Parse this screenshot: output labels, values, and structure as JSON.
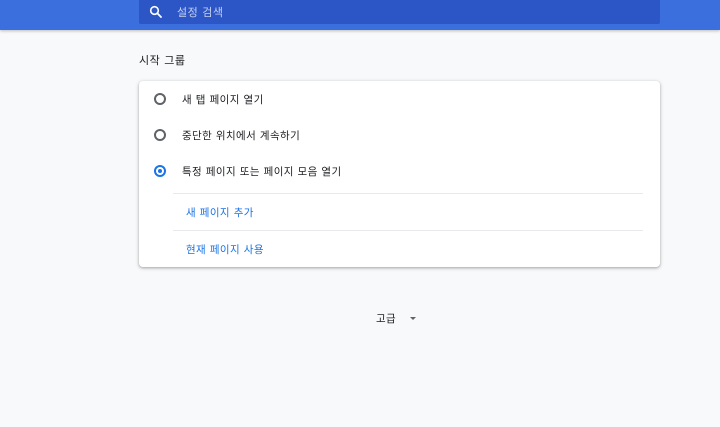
{
  "search": {
    "placeholder": "설정 검색",
    "icon": "search-icon"
  },
  "startup": {
    "title": "시작 그룹",
    "options": [
      {
        "label": "새 탭 페이지 열기",
        "checked": false
      },
      {
        "label": "중단한 위치에서 계속하기",
        "checked": false
      },
      {
        "label": "특정 페이지 또는 페이지 모음 열기",
        "checked": true
      }
    ],
    "links": {
      "add_page": "새 페이지 추가",
      "use_current": "현재 페이지 사용"
    }
  },
  "advanced": {
    "label": "고급",
    "icon": "dropdown-arrow-icon"
  },
  "colors": {
    "topbar": "#3b6fde",
    "search_box": "#2c55c5",
    "accent": "#1a73e8"
  }
}
